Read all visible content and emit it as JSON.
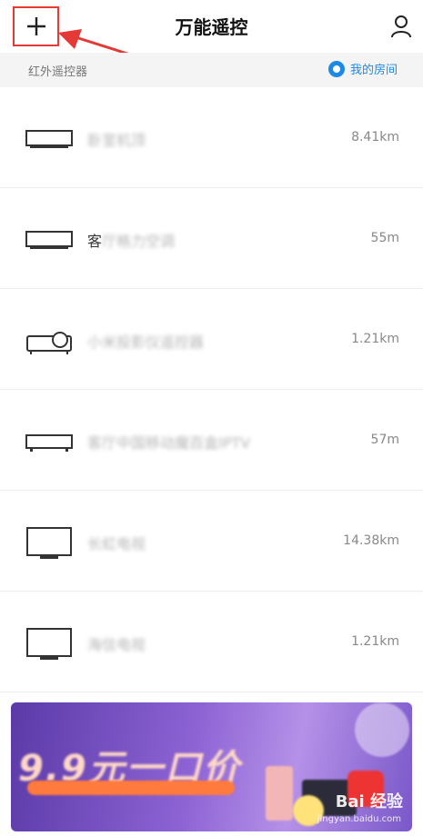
{
  "header": {
    "title": "万能遥控",
    "add_icon": "plus-icon",
    "user_icon": "user-icon"
  },
  "subheader": {
    "label": "红外遥控器",
    "room_link": "我的房间",
    "accent": "#1e88e5"
  },
  "devices": [
    {
      "icon": "settop-box-icon",
      "name_visible": "",
      "name_blurred": "卧室机顶",
      "distance": "8.41km"
    },
    {
      "icon": "settop-box-icon",
      "name_visible": "客",
      "name_blurred": "厅格力空调",
      "distance": "55m"
    },
    {
      "icon": "projector-icon",
      "name_visible": "",
      "name_blurred": "小米投影仪遥控器",
      "distance": "1.21km"
    },
    {
      "icon": "settop-box-icon",
      "name_visible": "",
      "name_blurred": "客厅中国移动魔百盒IPTV",
      "distance": "57m"
    },
    {
      "icon": "tv-icon",
      "name_visible": "",
      "name_blurred": "长虹电视",
      "distance": "14.38km"
    },
    {
      "icon": "tv-icon",
      "name_visible": "",
      "name_blurred": "海信电视",
      "distance": "1.21km"
    }
  ],
  "banner": {
    "headline": "9.9元一口价",
    "watermark": "Bai 经验",
    "url": "jingyan.baidu.com",
    "accent": "#ff7a3d"
  }
}
